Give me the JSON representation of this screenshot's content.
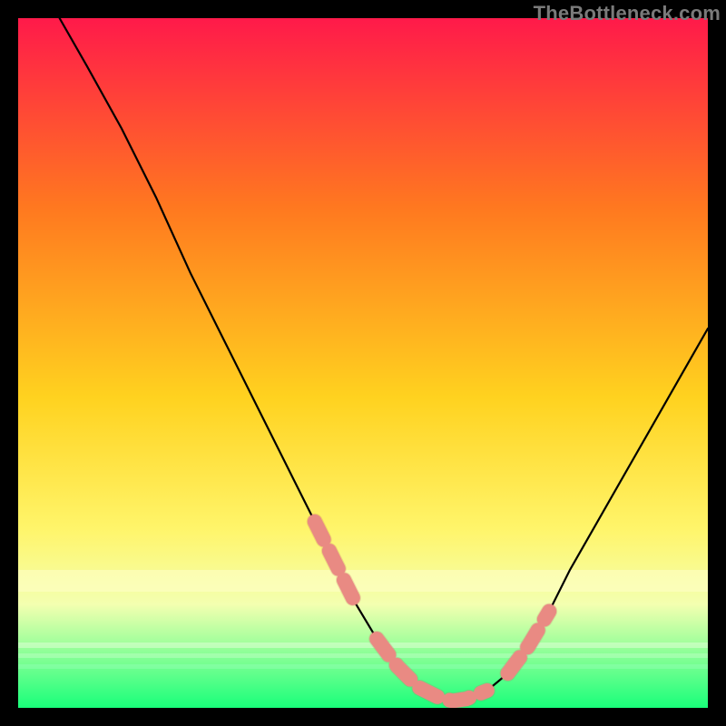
{
  "watermark": "TheBottleneck.com",
  "colors": {
    "bg_black": "#000000",
    "gradient_top": "#ff1a4a",
    "gradient_mid1": "#ff7a1f",
    "gradient_mid2": "#ffd21f",
    "gradient_mid3": "#fff56a",
    "gradient_band_pale": "#f3ffb0",
    "gradient_bottom": "#19ff7a",
    "curve_stroke": "#000000",
    "marker_fill": "#e98a83",
    "marker_stroke": "#c86a62"
  },
  "chart_data": {
    "type": "line",
    "title": "",
    "xlabel": "",
    "ylabel": "",
    "xlim": [
      0,
      100
    ],
    "ylim": [
      0,
      100
    ],
    "grid": false,
    "legend": false,
    "series": [
      {
        "name": "bottleneck-curve",
        "x": [
          6,
          10,
          15,
          20,
          25,
          30,
          35,
          40,
          43,
          46,
          49,
          52,
          55,
          58,
          61,
          63,
          65,
          68,
          71,
          74,
          77,
          80,
          84,
          88,
          92,
          96,
          100
        ],
        "y": [
          100,
          93,
          84,
          74,
          63,
          53,
          43,
          33,
          27,
          21,
          15,
          10,
          6,
          3,
          1.5,
          1,
          1.3,
          2.5,
          5,
          9,
          14,
          20,
          27,
          34,
          41,
          48,
          55
        ]
      }
    ],
    "highlight_segments": [
      {
        "x": [
          43,
          46,
          49
        ],
        "y": [
          27,
          21,
          15
        ]
      },
      {
        "x": [
          52,
          55,
          58,
          61,
          63,
          65,
          68
        ],
        "y": [
          10,
          6,
          3,
          1.5,
          1,
          1.3,
          2.5
        ]
      },
      {
        "x": [
          71,
          74,
          77
        ],
        "y": [
          5,
          9,
          14
        ]
      }
    ]
  }
}
